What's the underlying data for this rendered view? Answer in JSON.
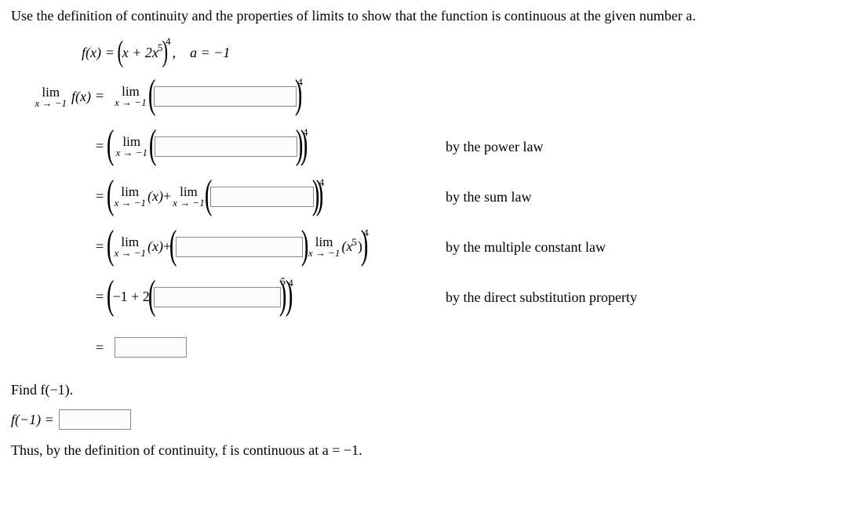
{
  "instruction": "Use the definition of continuity and the properties of limits to show that the function is continuous at the given number a.",
  "formula": {
    "fx": "f(x)",
    "eq": "=",
    "lp": "(",
    "body": "x + 2x",
    "exp5": "5",
    "rp": ")",
    "exp4": "4",
    "comma": ",",
    "a_eq": "a = −1"
  },
  "lhs": {
    "lim_top": "lim",
    "lim_bot": "x → −1",
    "fx": "f(x)"
  },
  "common": {
    "eq": "=",
    "lim_top": "lim",
    "lim_bot": "x → −1",
    "lp": "(",
    "rp": ")",
    "exp4": "4",
    "exp5": "5"
  },
  "step3": {
    "x": "(x)",
    "plus": " + "
  },
  "step4": {
    "x": "(x)",
    "plus": " + ",
    "x5": "(x",
    "x5_close": ")"
  },
  "step5": {
    "body": "−1 + 2"
  },
  "laws": {
    "power": "by the power law",
    "sum": "by the sum law",
    "mult": "by the multiple constant law",
    "direct": "by the direct substitution property"
  },
  "find": "Find f(−1).",
  "f_eval": "f(−1) =",
  "conclusion": "Thus, by the definition of continuity, f is continuous at a = −1."
}
